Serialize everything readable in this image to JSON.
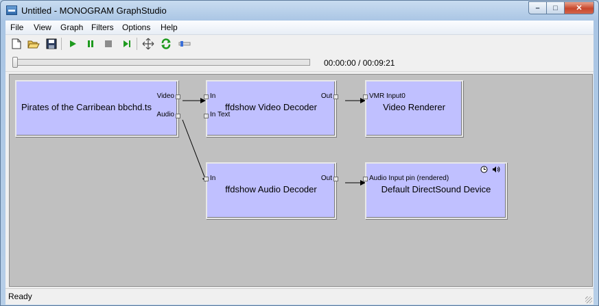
{
  "window": {
    "title": "Untitled - MONOGRAM GraphStudio",
    "controls": {
      "minimize": "–",
      "maximize": "□",
      "close": "✕"
    }
  },
  "menu": [
    {
      "label": "File"
    },
    {
      "label": "View"
    },
    {
      "label": "Graph"
    },
    {
      "label": "Filters"
    },
    {
      "label": "Options"
    },
    {
      "label": "Help"
    }
  ],
  "toolbar": [
    {
      "icon": "new-document-icon"
    },
    {
      "icon": "open-folder-icon"
    },
    {
      "icon": "save-icon"
    },
    {
      "icon": "play-icon"
    },
    {
      "icon": "pause-icon"
    },
    {
      "icon": "stop-icon"
    },
    {
      "icon": "step-forward-icon"
    },
    {
      "icon": "arrange-icon"
    },
    {
      "icon": "refresh-icon"
    },
    {
      "icon": "seek-icon"
    }
  ],
  "seekbar": {
    "position": 0.0,
    "time": "00:00:00 / 00:09:21"
  },
  "graph": {
    "filters": {
      "source": {
        "name": "Pirates of the Carribean bbchd.ts",
        "pins": [
          "Video",
          "Audio"
        ]
      },
      "video_decoder": {
        "name": "ffdshow Video Decoder",
        "pins": [
          "In",
          "In Text",
          "Out"
        ]
      },
      "video_renderer": {
        "name": "Video Renderer",
        "pins": [
          "VMR Input0"
        ]
      },
      "audio_decoder": {
        "name": "ffdshow Audio Decoder",
        "pins": [
          "In",
          "Out"
        ]
      },
      "audio_renderer": {
        "name": "Default DirectSound Device",
        "pins": [
          "Audio Input pin (rendered)"
        ]
      }
    }
  },
  "status": {
    "text": "Ready"
  },
  "colors": {
    "filter_fill": "#c0c0ff",
    "canvas": "#c0c0c0"
  }
}
